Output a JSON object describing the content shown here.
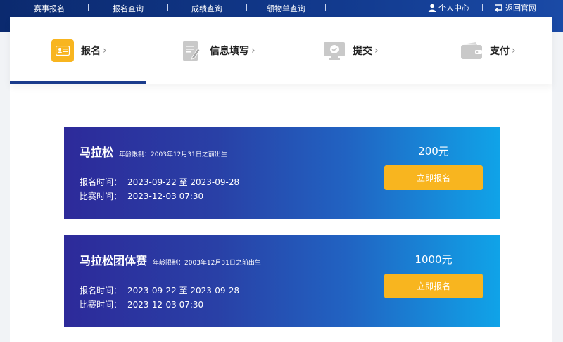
{
  "nav": {
    "links": [
      "赛事报名",
      "报名查询",
      "成绩查询",
      "领物单查询"
    ],
    "user_center": "个人中心",
    "back_site": "返回官网"
  },
  "steps": [
    {
      "label": "报名",
      "icon": "id-card-icon",
      "active": true
    },
    {
      "label": "信息填写",
      "icon": "form-edit-icon",
      "active": false
    },
    {
      "label": "提交",
      "icon": "monitor-check-icon",
      "active": false
    },
    {
      "label": "支付",
      "icon": "wallet-icon",
      "active": false
    }
  ],
  "events": [
    {
      "name": "马拉松",
      "age_limit": "年龄限制：2003年12月31日之前出生",
      "reg_label": "报名时间：",
      "reg_time": "2023-09-22 至 2023-09-28",
      "race_label": "比赛时间：",
      "race_time": "2023-12-03 07:30",
      "price": "200元",
      "button": "立即报名"
    },
    {
      "name": "马拉松团体赛",
      "age_limit": "年龄限制：2003年12月31日之前出生",
      "reg_label": "报名时间：",
      "reg_time": "2023-09-22 至 2023-09-28",
      "race_label": "比赛时间：",
      "race_time": "2023-12-03 07:30",
      "price": "1000元",
      "button": "立即报名"
    }
  ],
  "colors": {
    "nav_bg": "#0b2a6f",
    "active_bar": "#1b3c8c",
    "active_icon": "#f8b51f",
    "button": "#f8b51f",
    "card_start": "#2d2a9a",
    "card_end": "#10a3e8"
  }
}
